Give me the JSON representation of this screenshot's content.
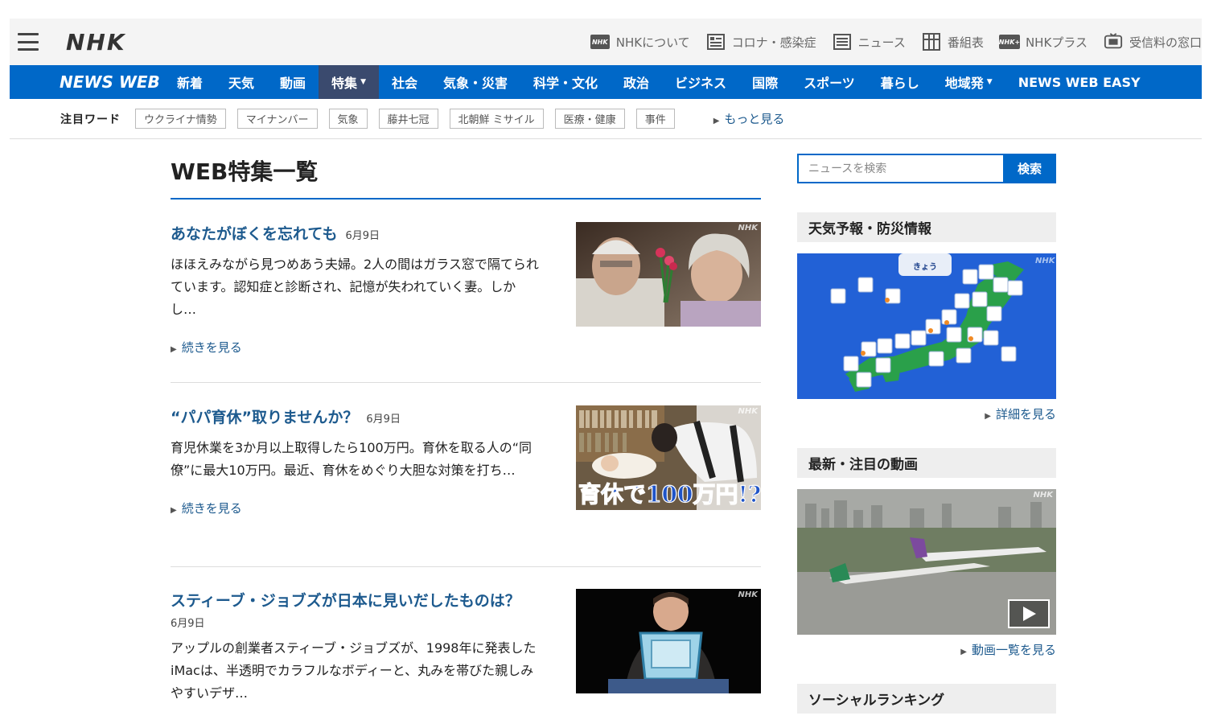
{
  "header": {
    "brand": "NHK",
    "utility": [
      {
        "label": "NHKについて",
        "icon": "nhk-logo-icon"
      },
      {
        "label": "コロナ・感染症",
        "icon": "corona-icon"
      },
      {
        "label": "ニュース",
        "icon": "news-icon"
      },
      {
        "label": "番組表",
        "icon": "program-grid-icon"
      },
      {
        "label": "NHKプラス",
        "icon": "nhk-plus-icon"
      },
      {
        "label": "受信料の窓口",
        "icon": "reception-fee-icon"
      }
    ]
  },
  "nav": {
    "logo": "NEWS WEB",
    "items": [
      "新着",
      "天気",
      "動画",
      "特集",
      "社会",
      "気象・災害",
      "科学・文化",
      "政治",
      "ビジネス",
      "国際",
      "スポーツ",
      "暮らし",
      "地域発",
      "NEWS WEB EASY"
    ],
    "active": "特集"
  },
  "words": {
    "label": "注目ワード",
    "tags": [
      "ウクライナ情勢",
      "マイナンバー",
      "気象",
      "藤井七冠",
      "北朝鮮 ミサイル",
      "医療・健康",
      "事件"
    ],
    "more": "もっと見る"
  },
  "page": {
    "title": "WEB特集一覧"
  },
  "articles": [
    {
      "title": "あなたがぼくを忘れても",
      "date": "6月9日",
      "text": "ほほえみながら見つめあう夫婦。2人の間はガラス窓で隔てられています。認知症と診断され、記憶が失われていく妻。しかし…",
      "more": "続きを見る"
    },
    {
      "title": "“パパ育休”取りませんか？",
      "date": "6月9日",
      "text": "育児休業を3か月以上取得したら100万円。育休を取る人の“同僚”に最大10万円。最近、育休をめぐり大胆な対策を打ち…",
      "more": "続きを見る",
      "image_caption": "育休で100万円!?"
    },
    {
      "title": "スティーブ・ジョブズが日本に見いだしたものは？",
      "date": "6月9日",
      "text": "アップルの創業者スティーブ・ジョブズが、1998年に発表したiMacは、半透明でカラフルなボディーと、丸みを帯びた親しみやすいデザ…"
    }
  ],
  "sidebar": {
    "search_placeholder": "ニュースを検索",
    "search_button": "検索",
    "weather_heading": "天気予報・防災情報",
    "weather_tab": "きょう",
    "weather_more": "詳細を見る",
    "video_heading": "最新・注目の動画",
    "video_more": "動画一覧を見る",
    "social_heading": "ソーシャルランキング"
  },
  "watermark": "NHK",
  "colors": {
    "brand_blue": "#0068c8",
    "link_blue": "#1d5a8e",
    "active_nav": "#3a4a6e"
  }
}
